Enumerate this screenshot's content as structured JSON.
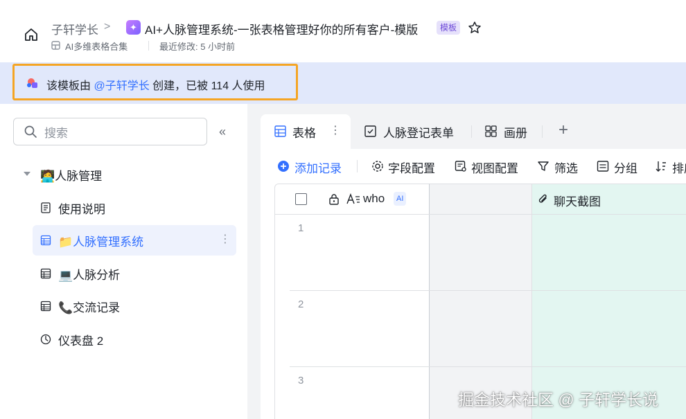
{
  "header": {
    "owner": "子轩学长",
    "crumb_separator": ">",
    "doc_title": "AI+人脉管理系统-一张表格管理好你的所有客户-模版",
    "template_badge": "模板",
    "doc_type": "AI多维表格合集",
    "last_modified": "最近修改: 5 小时前"
  },
  "banner": {
    "prefix": "该模板由 ",
    "mention": "@子轩学长",
    "suffix": " 创建，已被 114 人使用"
  },
  "sidebar": {
    "search_placeholder": "搜索",
    "collapse_glyph": "«",
    "root_label": "🧑‍💻人脉管理",
    "items": [
      {
        "label": "使用说明",
        "icon": "doc-icon"
      },
      {
        "label": "📁人脉管理系统",
        "icon": "table-icon",
        "active": true
      },
      {
        "label": "💻人脉分析",
        "icon": "table-icon"
      },
      {
        "label": "📞交流记录",
        "icon": "table-icon"
      },
      {
        "label": "仪表盘 2",
        "icon": "dashboard-icon"
      }
    ],
    "more_glyph": "⋮"
  },
  "tabs": [
    {
      "label": "表格",
      "icon": "grid-view-icon",
      "active": true
    },
    {
      "label": "人脉登记表单",
      "icon": "form-icon"
    },
    {
      "label": "画册",
      "icon": "gallery-icon"
    }
  ],
  "tab_more_glyph": "⋮",
  "tab_add_glyph": "+",
  "toolbar": {
    "add_record": "添加记录",
    "field_config": "字段配置",
    "view_config": "视图配置",
    "filter": "筛选",
    "group": "分组",
    "sort": "排序"
  },
  "grid": {
    "columns": [
      {
        "label": "who",
        "badge": "AI"
      },
      {
        "label": "聊天截图"
      }
    ],
    "rows": [
      "1",
      "2",
      "3"
    ]
  },
  "watermark": "掘金技术社区 @ 子轩学长说",
  "colors": {
    "accent": "#3370ff",
    "banner_bg": "#e1e8fb",
    "highlight_border": "#f5a524",
    "attachment_column_bg": "#e3f6f1"
  }
}
